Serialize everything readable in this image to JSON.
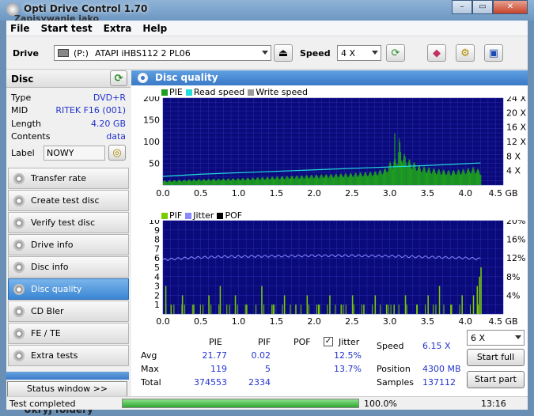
{
  "window": {
    "title": "Opti Drive Control 1.70",
    "subtitle": "Zapisywanie jako"
  },
  "menu": [
    "File",
    "Start test",
    "Extra",
    "Help"
  ],
  "drive": {
    "label": "Drive",
    "letter": "(P:)",
    "name": "ATAPI  iHBS112   2 PL06",
    "speed_label": "Speed",
    "speed_value": "4 X"
  },
  "disc": {
    "header": "Disc",
    "rows": [
      {
        "key": "Type",
        "value": "DVD+R"
      },
      {
        "key": "MID",
        "value": "RITEK F16 (001)"
      },
      {
        "key": "Length",
        "value": "4.20 GB"
      },
      {
        "key": "Contents",
        "value": "data"
      }
    ],
    "label_key": "Label",
    "label_value": "NOWY"
  },
  "nav": [
    "Transfer rate",
    "Create test disc",
    "Verify test disc",
    "Drive info",
    "Disc info",
    "Disc quality",
    "CD Bler",
    "FE / TE",
    "Extra tests"
  ],
  "nav_active": "Disc quality",
  "status_window_button": "Status window >>",
  "main": {
    "title": "Disc quality"
  },
  "chart_data": [
    {
      "type": "bar",
      "legend": [
        "PIE",
        "Read speed",
        "Write speed"
      ],
      "colors": {
        "PIE": "#1e9e1e",
        "Read speed": "#22dddd",
        "Write speed": "#9a9a9a"
      },
      "x_ticks": [
        "0.0",
        "0.5",
        "1.0",
        "1.5",
        "2.0",
        "2.5",
        "3.0",
        "3.5",
        "4.0",
        "4.5 GB"
      ],
      "y_left_ticks": [
        "200",
        "150",
        "100",
        "50"
      ],
      "y_right_ticks": [
        "24 X",
        "20 X",
        "16 X",
        "12 X",
        "8 X",
        "4 X"
      ],
      "xlim": [
        0,
        4.5
      ],
      "ylim": [
        0,
        200
      ],
      "y2lim": [
        0,
        24
      ],
      "pie_envelope": [
        [
          0.0,
          10
        ],
        [
          0.2,
          12
        ],
        [
          0.5,
          14
        ],
        [
          1.0,
          16
        ],
        [
          1.5,
          20
        ],
        [
          2.0,
          24
        ],
        [
          2.5,
          28
        ],
        [
          2.8,
          32
        ],
        [
          2.95,
          40
        ],
        [
          3.0,
          55
        ],
        [
          3.05,
          60
        ],
        [
          3.1,
          70
        ],
        [
          3.12,
          110
        ],
        [
          3.15,
          80
        ],
        [
          3.25,
          60
        ],
        [
          3.4,
          45
        ],
        [
          3.6,
          38
        ],
        [
          3.8,
          34
        ],
        [
          4.0,
          38
        ],
        [
          4.1,
          42
        ],
        [
          4.2,
          35
        ]
      ],
      "read_speed": [
        [
          0.0,
          2.4
        ],
        [
          0.5,
          3.0
        ],
        [
          1.0,
          3.4
        ],
        [
          1.5,
          3.8
        ],
        [
          2.0,
          4.2
        ],
        [
          2.5,
          4.6
        ],
        [
          3.0,
          5.0
        ],
        [
          3.5,
          5.4
        ],
        [
          4.0,
          5.9
        ],
        [
          4.2,
          6.1
        ]
      ]
    },
    {
      "type": "bar",
      "legend": [
        "PIF",
        "Jitter",
        "POF"
      ],
      "colors": {
        "PIF": "#7acc00",
        "Jitter": "#8888ff",
        "POF": "#000000"
      },
      "x_ticks": [
        "0.0",
        "0.5",
        "1.0",
        "1.5",
        "2.0",
        "2.5",
        "3.0",
        "3.5",
        "4.0",
        "4.5 GB"
      ],
      "y_left_ticks": [
        "10",
        "9",
        "8",
        "7",
        "6",
        "5",
        "4",
        "3",
        "2",
        "1"
      ],
      "y_right_ticks": [
        "20%",
        "16%",
        "12%",
        "8%",
        "4%"
      ],
      "xlim": [
        0,
        4.5
      ],
      "ylim": [
        0,
        10
      ],
      "y2lim": [
        0,
        20
      ],
      "jitter": [
        [
          0.0,
          11.6
        ],
        [
          0.3,
          12.0
        ],
        [
          0.8,
          12.3
        ],
        [
          1.5,
          12.4
        ],
        [
          2.0,
          12.5
        ],
        [
          2.5,
          12.5
        ],
        [
          3.0,
          12.4
        ],
        [
          3.5,
          12.2
        ],
        [
          4.0,
          12.0
        ],
        [
          4.2,
          11.8
        ]
      ],
      "pif_spikes": [
        [
          0.03,
          3
        ],
        [
          0.1,
          1
        ],
        [
          0.25,
          2
        ],
        [
          0.4,
          1
        ],
        [
          0.6,
          2
        ],
        [
          0.75,
          3
        ],
        [
          0.95,
          2
        ],
        [
          1.1,
          1
        ],
        [
          1.3,
          3
        ],
        [
          1.45,
          1
        ],
        [
          1.6,
          2
        ],
        [
          1.75,
          1
        ],
        [
          1.9,
          2
        ],
        [
          2.05,
          1
        ],
        [
          2.2,
          2
        ],
        [
          2.35,
          1
        ],
        [
          2.5,
          2
        ],
        [
          2.65,
          1
        ],
        [
          2.8,
          2
        ],
        [
          2.95,
          1
        ],
        [
          3.05,
          1
        ],
        [
          3.2,
          2
        ],
        [
          3.35,
          1
        ],
        [
          3.5,
          2
        ],
        [
          3.65,
          3
        ],
        [
          3.8,
          1
        ],
        [
          3.95,
          2
        ],
        [
          4.1,
          2
        ],
        [
          4.15,
          3
        ],
        [
          4.18,
          4
        ],
        [
          4.2,
          5
        ]
      ]
    }
  ],
  "stats": {
    "col_pie": "PIE",
    "col_pif": "PIF",
    "col_pof": "POF",
    "col_jitter": "Jitter",
    "avg_label": "Avg",
    "avg_pie": "21.77",
    "avg_pif": "0.02",
    "avg_jitter": "12.5%",
    "max_label": "Max",
    "max_pie": "119",
    "max_pif": "5",
    "max_jitter": "13.7%",
    "total_label": "Total",
    "total_pie": "374553",
    "total_pif": "2334",
    "speed_label": "Speed",
    "speed_value": "6.15 X",
    "position_label": "Position",
    "position_value": "4300 MB",
    "samples_label": "Samples",
    "samples_value": "137112",
    "speed_select": "6 X",
    "start_full": "Start full",
    "start_part": "Start part"
  },
  "statusbar": {
    "text": "Test completed",
    "percent": "100.0%",
    "progress_fraction": 1.0,
    "time": "13:16"
  },
  "behind_text": "Ukryj foldery"
}
